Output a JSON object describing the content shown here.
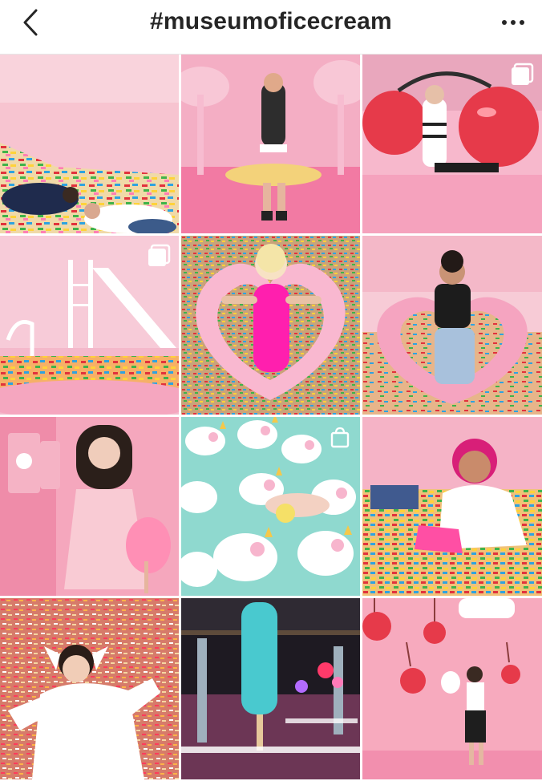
{
  "header": {
    "title": "#museumoficecream",
    "back_icon": "chevron-left-icon",
    "more_icon": "more-horizontal-icon"
  },
  "colors": {
    "pink_light": "#f7c6d3",
    "pink_mid": "#f3a6bd",
    "pink_hot": "#ff3fa4",
    "mint": "#8fd9cf",
    "cherry_red": "#e63a4a"
  },
  "grid": {
    "tiles": [
      {
        "id": "sprinkle-pool-couple",
        "badge": null
      },
      {
        "id": "pink-palm-swing",
        "badge": null
      },
      {
        "id": "giant-cherries",
        "badge": "multiple-photos-icon"
      },
      {
        "id": "sprinkle-pool-slide",
        "badge": "multiple-photos-icon"
      },
      {
        "id": "heart-float-sprinkles",
        "badge": null
      },
      {
        "id": "pink-float-pose",
        "badge": null
      },
      {
        "id": "pink-phone-booth",
        "badge": null
      },
      {
        "id": "unicorn-squishies",
        "badge": "shopping-bag-icon"
      },
      {
        "id": "sprinkle-pool-smile",
        "badge": null
      },
      {
        "id": "sprinkle-lying-man",
        "badge": null
      },
      {
        "id": "popsicle-dining-hall",
        "badge": null
      },
      {
        "id": "hanging-cherries-room",
        "badge": null
      }
    ]
  }
}
